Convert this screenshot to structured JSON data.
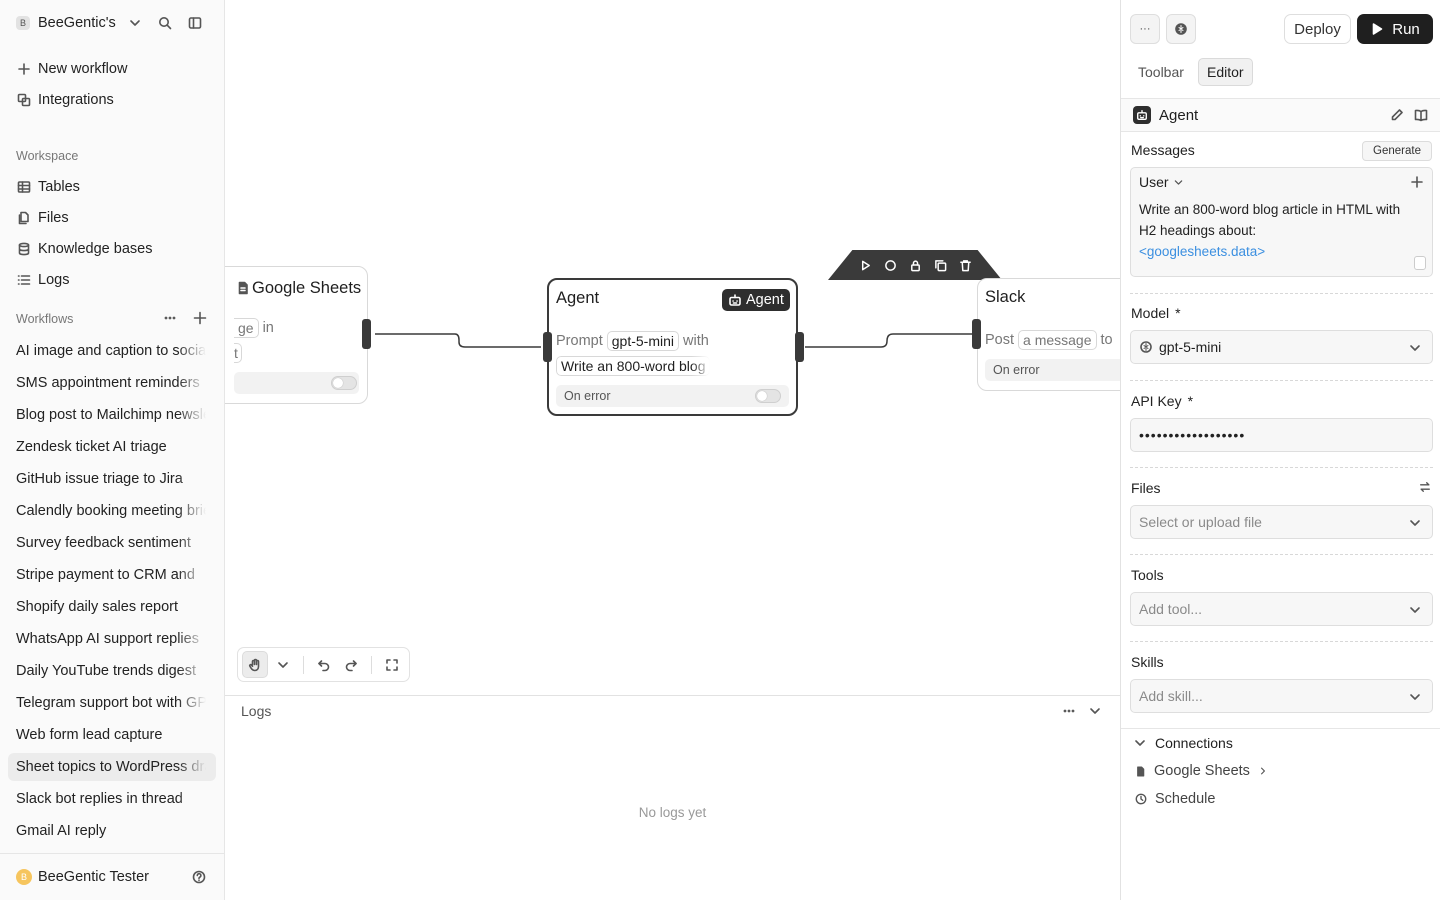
{
  "sidebar": {
    "workspace_badge": "B",
    "workspace_name": "BeeGentic's",
    "items": [
      {
        "label": "New workflow"
      },
      {
        "label": "Integrations"
      }
    ],
    "workspace_section": "Workspace",
    "workspace_items": [
      {
        "label": "Tables"
      },
      {
        "label": "Files"
      },
      {
        "label": "Knowledge bases"
      },
      {
        "label": "Logs"
      }
    ],
    "workflows_section": "Workflows",
    "workflows": [
      "AI image and caption to social",
      "SMS appointment reminders",
      "Blog post to Mailchimp newsletter",
      "Zendesk ticket AI triage",
      "GitHub issue triage to Jira",
      "Calendly booking meeting brief",
      "Survey feedback sentiment",
      "Stripe payment to CRM and",
      "Shopify daily sales report",
      "WhatsApp AI support replies",
      "Daily YouTube trends digest",
      "Telegram support bot with GPT",
      "Web form lead capture",
      "Sheet topics to WordPress drafts",
      "Slack bot replies in thread",
      "Gmail AI reply"
    ],
    "active_workflow_index": 13,
    "user_initial": "B",
    "user_name": "BeeGentic Tester"
  },
  "canvas": {
    "sheets_node": {
      "title": "Google Sheets",
      "row_chip": "ge",
      "row_text": "in",
      "row2_chip": "t"
    },
    "agent_node": {
      "title": "Agent",
      "badge": "Agent",
      "prompt_label": "Prompt",
      "model_chip": "gpt-5-mini",
      "with_text": "with",
      "prompt_chip": "Write an 800-word blog",
      "on_error": "On error"
    },
    "slack_node": {
      "title": "Slack",
      "post_label": "Post",
      "post_chip": "a message",
      "to_text": "to",
      "on_error": "On error"
    }
  },
  "logs": {
    "title": "Logs",
    "empty": "No logs yet"
  },
  "panel": {
    "more_label": "···",
    "deploy_label": "Deploy",
    "run_label": "Run",
    "tabs": [
      "Toolbar",
      "Editor"
    ],
    "active_tab": 1,
    "block_name": "Agent",
    "messages_label": "Messages",
    "generate_label": "Generate",
    "message_role": "User",
    "message_text": "Write an 800-word blog article in HTML with H2 headings about:",
    "message_tag": "<googlesheets.data>",
    "model_label": "Model",
    "model_value": "gpt-5-mini",
    "api_key_label": "API Key",
    "api_key_value": "••••••••••••••••••",
    "files_label": "Files",
    "files_placeholder": "Select or upload file",
    "tools_label": "Tools",
    "tools_placeholder": "Add tool...",
    "skills_label": "Skills",
    "skills_placeholder": "Add skill...",
    "required_mark": "*",
    "connections_label": "Connections",
    "connections": [
      "Google Sheets",
      "Schedule"
    ]
  }
}
